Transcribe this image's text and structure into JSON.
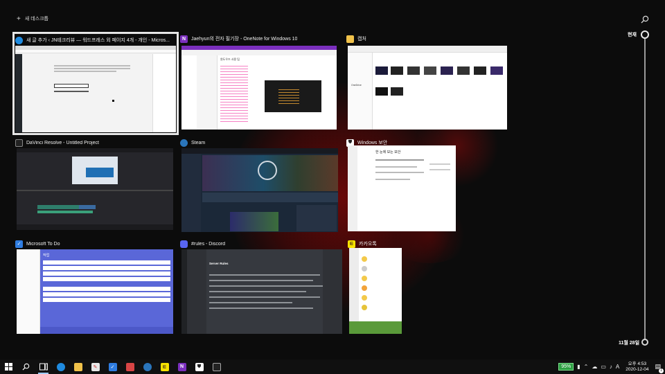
{
  "top": {
    "new_desktop_label": "새 데스크톱"
  },
  "windows": [
    {
      "id": "edge",
      "title": "새 글 추가 ‹ JN테크리뷰 — 워드프레스 외 페이지 4개 - 개인 - Micros...",
      "icon": "edge-icon",
      "color": "#1f8be0",
      "selected": true
    },
    {
      "id": "onenote",
      "title": "Jaehyun의 전자 필기장 - OneNote for Windows 10",
      "icon": "onenote-icon",
      "color": "#7b2fbe",
      "selected": false
    },
    {
      "id": "capture",
      "title": "캡처",
      "icon": "folder-icon",
      "color": "#f1c24a",
      "selected": false
    },
    {
      "id": "davinci",
      "title": "DaVinci Resolve - Untitled Project",
      "icon": "davinci-icon",
      "color": "#222222",
      "selected": false
    },
    {
      "id": "steam",
      "title": "Steam",
      "icon": "steam-icon",
      "color": "#2a75bb",
      "selected": false
    },
    {
      "id": "security",
      "title": "Windows 보안",
      "icon": "shield-icon",
      "color": "#ffffff",
      "selected": false
    },
    {
      "id": "todo",
      "title": "Microsoft To Do",
      "icon": "todo-check-icon",
      "color": "#2f7de1",
      "selected": false
    },
    {
      "id": "discord",
      "title": "#rules - Discord",
      "icon": "discord-icon",
      "color": "#5865f2",
      "selected": false
    },
    {
      "id": "kakao",
      "title": "카카오톡",
      "icon": "kakaotalk-icon",
      "color": "#f7e300",
      "selected": false
    }
  ],
  "timeline": {
    "now_label": "현재",
    "date_label": "11월 28일"
  },
  "taskbar": {
    "battery": "95%",
    "ime": "A",
    "time": "오후 4:53",
    "date": "2020-12-04",
    "notification_count": "1",
    "apps": [
      "start-icon",
      "search-icon",
      "task-view-icon",
      "edge-icon",
      "file-explorer-icon",
      "paint-icon",
      "todo-check-icon",
      "photos-icon",
      "steam-icon",
      "kakaotalk-icon",
      "onenote-icon",
      "shield-icon",
      "davinci-icon"
    ]
  },
  "thumb_text": {
    "onenote_page": "윈도우즈 사용 팁",
    "security_heading": "한 눈에 보는 보안",
    "todo_list": "작업",
    "discord_channel": "Server Rules",
    "explorer_sidebar": "OneDrive"
  }
}
